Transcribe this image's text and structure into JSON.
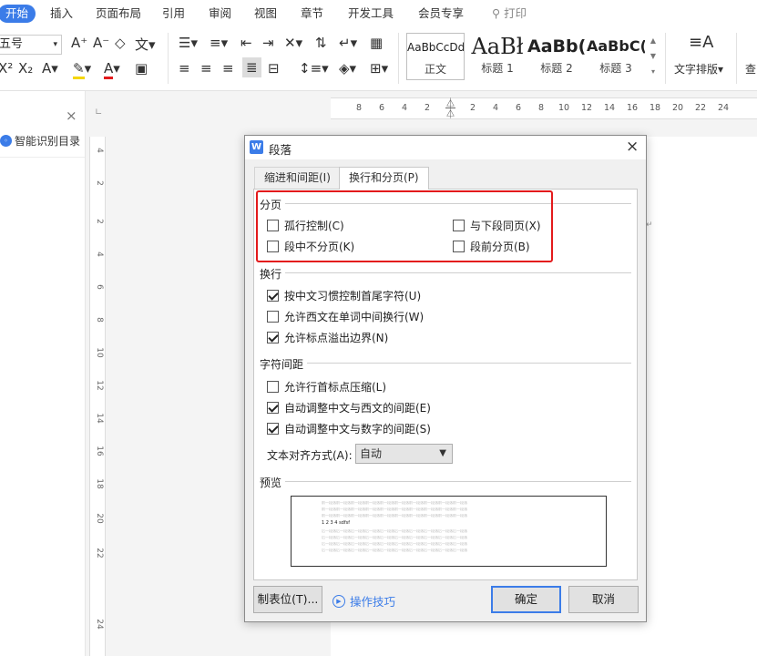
{
  "menu": {
    "tabs": [
      "开始",
      "插入",
      "页面布局",
      "引用",
      "审阅",
      "视图",
      "章节",
      "开发工具",
      "会员专享"
    ],
    "search_label": "打印"
  },
  "ribbon": {
    "font_size_value": "五号",
    "styles": [
      {
        "sample": "AaBbCcDd",
        "name": "正文"
      },
      {
        "sample": "AaBł",
        "name": "标题 1"
      },
      {
        "sample": "AaBb(",
        "name": "标题 2"
      },
      {
        "sample": "AaBbC(",
        "name": "标题 3"
      }
    ],
    "text_layout_label": "文字排版",
    "find_label": "查"
  },
  "left_panel": {
    "title": "智能识别目录",
    "close": "×"
  },
  "hruler": [
    "8",
    "6",
    "4",
    "2",
    "2",
    "4",
    "6",
    "8",
    "10",
    "12",
    "14",
    "16",
    "18",
    "20",
    "22",
    "24"
  ],
  "vruler": [
    "4",
    "2",
    "2",
    "4",
    "6",
    "8",
    "10",
    "12",
    "14",
    "16",
    "18",
    "20",
    "22",
    "24"
  ],
  "dialog": {
    "title": "段落",
    "close": "×",
    "tabs": [
      "缩进和间距(I)",
      "换行和分页(P)"
    ],
    "sections": {
      "pagination": "分页",
      "line_break": "换行",
      "char_spacing": "字符间距",
      "preview": "预览"
    },
    "checkboxes": {
      "widow_control": {
        "label": "孤行控制(C)",
        "checked": false
      },
      "keep_with_next": {
        "label": "与下段同页(X)",
        "checked": false
      },
      "keep_lines": {
        "label": "段中不分页(K)",
        "checked": false
      },
      "page_break_before": {
        "label": "段前分页(B)",
        "checked": false
      },
      "cjk_rules": {
        "label": "按中文习惯控制首尾字符(U)",
        "checked": true
      },
      "word_wrap": {
        "label": "允许西文在单词中间换行(W)",
        "checked": false
      },
      "hanging_punct": {
        "label": "允许标点溢出边界(N)",
        "checked": true
      },
      "compress_punct": {
        "label": "允许行首标点压缩(L)",
        "checked": false
      },
      "auto_space_latin": {
        "label": "自动调整中文与西文的间距(E)",
        "checked": true
      },
      "auto_space_digit": {
        "label": "自动调整中文与数字的间距(S)",
        "checked": true
      }
    },
    "text_align_label": "文本对齐方式(A):",
    "text_align_value": "自动",
    "preview_text": {
      "prev": "前一段落前一段落前一段落前一段落前一段落前一段落前一段落前一段落前一段落前一段落",
      "current": "1 2 3 4  sdfsf",
      "next": "后一段落后一段落后一段落后一段落后一段落后一段落后一段落后一段落后一段落后一段落"
    },
    "buttons": {
      "tabs": "制表位(T)...",
      "tips": "操作技巧",
      "ok": "确定",
      "cancel": "取消"
    }
  },
  "colors": {
    "accent": "#3b7ce8",
    "highlight": "#e31a1c"
  }
}
